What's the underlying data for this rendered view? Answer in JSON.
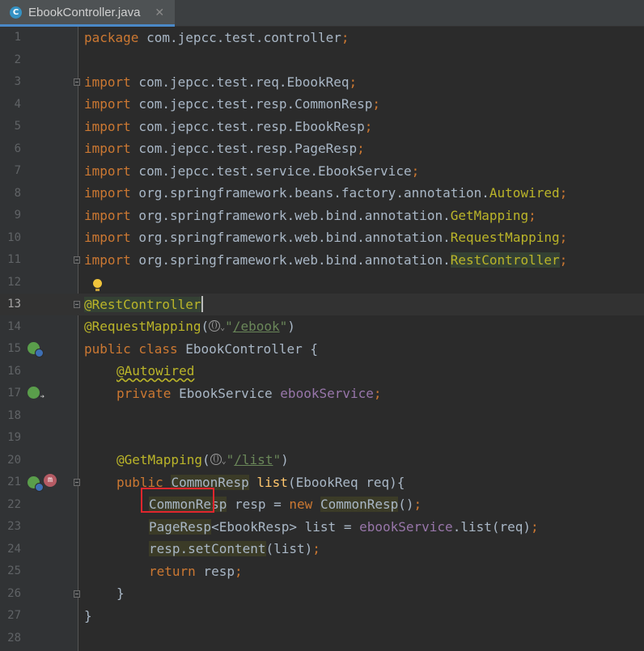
{
  "tab": {
    "icon_letter": "C",
    "title": "EbookController.java",
    "close": "✕"
  },
  "current_line": 13,
  "line_numbers": [
    "1",
    "2",
    "3",
    "4",
    "5",
    "6",
    "7",
    "8",
    "9",
    "10",
    "11",
    "12",
    "13",
    "14",
    "15",
    "16",
    "17",
    "18",
    "19",
    "20",
    "21",
    "22",
    "23",
    "24",
    "25",
    "26",
    "27",
    "28"
  ],
  "code": {
    "l1": {
      "package": "package",
      "name": " com.jepcc.test.controller",
      "semi": ";"
    },
    "l3": {
      "kw": "import",
      "path": " com.jepcc.test.req.EbookReq",
      "semi": ";"
    },
    "l4": {
      "kw": "import",
      "path": " com.jepcc.test.resp.CommonResp",
      "semi": ";"
    },
    "l5": {
      "kw": "import",
      "path": " com.jepcc.test.resp.EbookResp",
      "semi": ";"
    },
    "l6": {
      "kw": "import",
      "path": " com.jepcc.test.resp.PageResp",
      "semi": ";"
    },
    "l7": {
      "kw": "import",
      "path": " com.jepcc.test.service.EbookService",
      "semi": ";"
    },
    "l8": {
      "kw": "import",
      "path": " org.springframework.beans.factory.annotation.",
      "cls": "Autowired",
      "semi": ";"
    },
    "l9": {
      "kw": "import",
      "path": " org.springframework.web.bind.annotation.",
      "cls": "GetMapping",
      "semi": ";"
    },
    "l10": {
      "kw": "import",
      "path": " org.springframework.web.bind.annotation.",
      "cls": "RequestMapping",
      "semi": ";"
    },
    "l11": {
      "kw": "import",
      "path": " org.springframework.web.bind.annotation.",
      "cls": "RestController",
      "semi": ";"
    },
    "l13": {
      "ann": "@RestController"
    },
    "l14": {
      "ann": "@RequestMapping",
      "open": "(",
      "q1": "\"",
      "url": "/ebook",
      "q2": "\"",
      "close": ")"
    },
    "l15": {
      "kw": "public class",
      "name": " EbookController {"
    },
    "l16": {
      "ann": "@Autowired"
    },
    "l17": {
      "kw": "private",
      "type": " EbookService ",
      "field": "ebookService",
      "semi": ";"
    },
    "l20": {
      "ann": "@GetMapping",
      "open": "(",
      "q1": "\"",
      "url": "/list",
      "q2": "\"",
      "close": ")"
    },
    "l21": {
      "kw": "public",
      "type": "CommonResp",
      "method": "list",
      "params": "(EbookReq req){"
    },
    "l22": {
      "type": "CommonResp",
      "mid": " resp = ",
      "kw": "new",
      "type2": "CommonResp",
      "end": "()",
      "semi": ";"
    },
    "l23": {
      "type": "PageResp",
      "generic": "<EbookResp> list = ",
      "field": "ebookService",
      "call": ".list(req)",
      "semi": ";"
    },
    "l24": {
      "stmt": "resp.setContent",
      "args": "(list)",
      "semi": ";"
    },
    "l25": {
      "kw": "return",
      "rest": " resp",
      "semi": ";"
    },
    "l26": {
      "brace": "}"
    },
    "l27": {
      "brace": "}"
    }
  },
  "colors": {
    "background": "#2b2b2b",
    "gutter": "#313335",
    "keyword": "#cc7832",
    "annotation": "#bbb529",
    "string": "#6a8759",
    "field": "#9876aa",
    "method": "#ffc66d",
    "text": "#a9b7c6",
    "highlight_box": "#e0262d"
  }
}
